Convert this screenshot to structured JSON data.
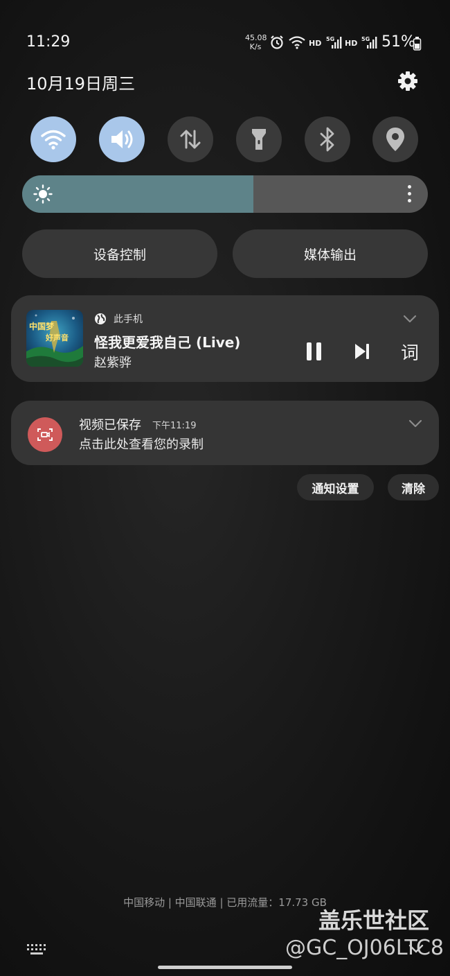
{
  "status_bar": {
    "time": "11:29",
    "net_speed_value": "45.08",
    "net_speed_unit": "K/s",
    "hd_1": "HD",
    "hd_2": "HD",
    "five_g_1": "5G",
    "five_g_2": "5G",
    "battery": "51%"
  },
  "header": {
    "date": "10月19日周三"
  },
  "quick_toggles": [
    {
      "name": "wifi",
      "icon": "wifi-icon",
      "active": true
    },
    {
      "name": "sound",
      "icon": "sound-icon",
      "active": true
    },
    {
      "name": "mobile-data",
      "icon": "data-arrows-icon",
      "active": false
    },
    {
      "name": "flashlight",
      "icon": "flashlight-icon",
      "active": false
    },
    {
      "name": "bluetooth",
      "icon": "bluetooth-icon",
      "active": false
    },
    {
      "name": "location",
      "icon": "location-icon",
      "active": false
    }
  ],
  "brightness": {
    "level": 0.57,
    "icon": "sun-icon"
  },
  "panel_buttons": {
    "device_control": "设备控制",
    "media_output": "媒体输出"
  },
  "media": {
    "device": "此手机",
    "title": "怪我更爱我自己 (Live)",
    "artist": "赵紫骅",
    "lyrics_label": "词",
    "album_title_line1": "中国梦",
    "album_title_line2": "好声音"
  },
  "notification": {
    "title": "视频已保存",
    "time": "下午11:19",
    "body": "点击此处查看您的录制"
  },
  "notification_actions": {
    "settings": "通知设置",
    "clear": "清除"
  },
  "footer": {
    "carrier_info": "中国移动 | 中国联通 | 已用流量：17.73 GB"
  },
  "watermark": {
    "site": "盖乐世社区",
    "user": "@GC_OJ06LTC8"
  },
  "colors": {
    "toggle_active": "#a9c7ea",
    "toggle_inactive": "#3a3a3a",
    "brightness_fill": "#5e8389",
    "record_red": "#cf5a5a"
  }
}
